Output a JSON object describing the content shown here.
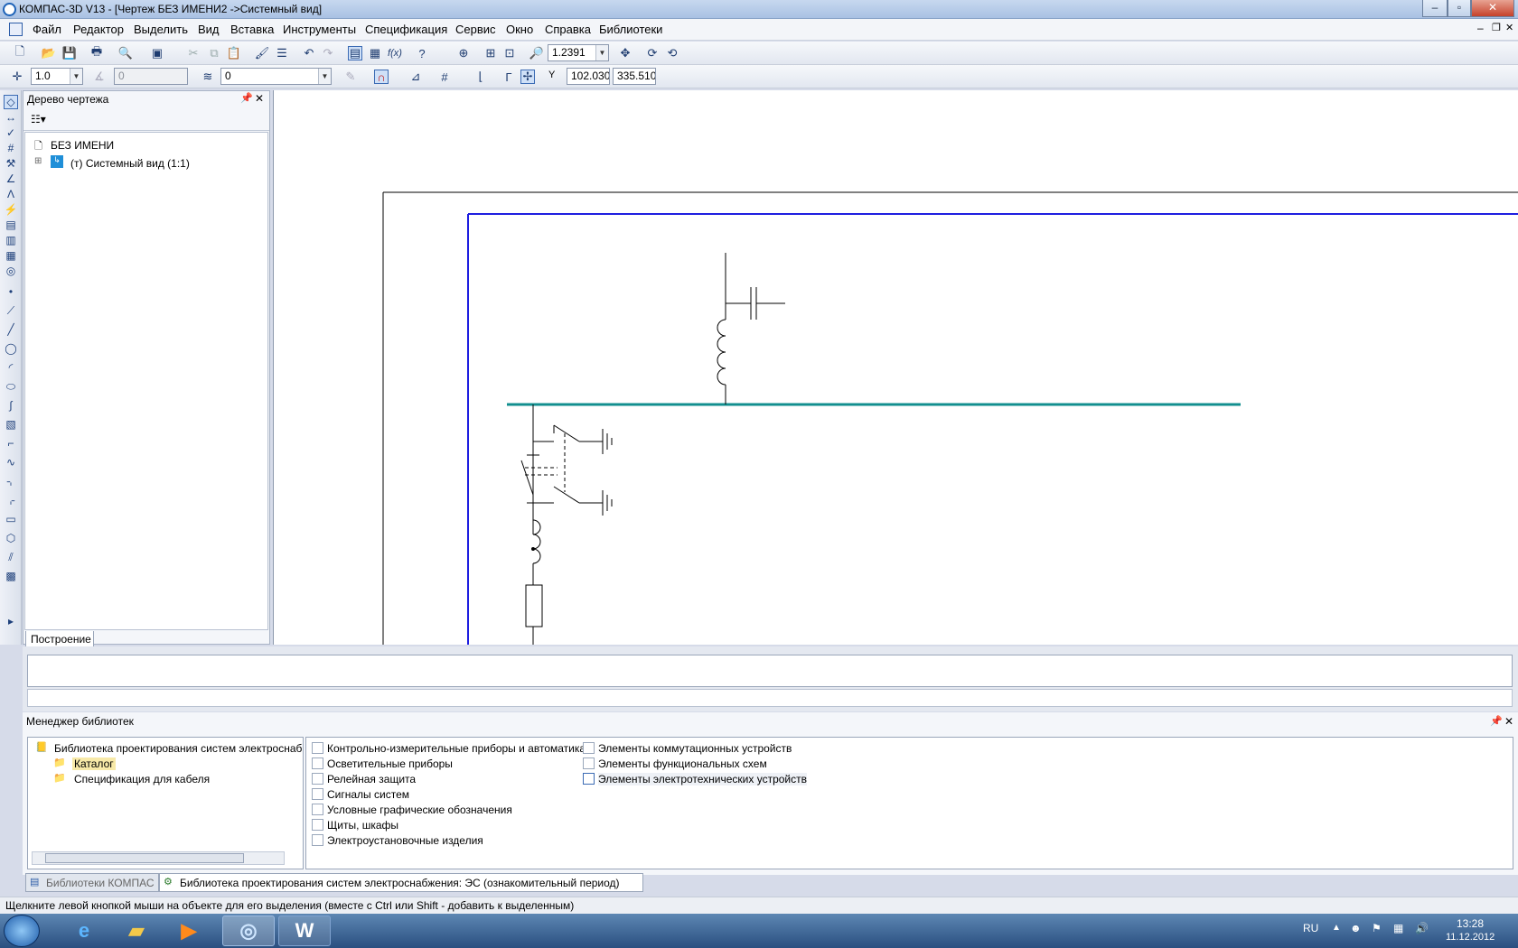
{
  "window": {
    "title": "КОМПАС-3D V13 - [Чертеж БЕЗ ИМЕНИ2 ->Системный вид]",
    "minimize": "–",
    "maximize": "▫",
    "close": "✕"
  },
  "menu": [
    "Файл",
    "Редактор",
    "Выделить",
    "Вид",
    "Вставка",
    "Инструменты",
    "Спецификация",
    "Сервис",
    "Окно",
    "Справка",
    "Библиотеки"
  ],
  "toolbar": {
    "zoom_value": "1.2391"
  },
  "toolbar2": {
    "step_value": "1.0",
    "angle_value": "0",
    "layer_value": "0",
    "x_label": "Y",
    "x_value": "102.030",
    "y_value": "335.510"
  },
  "tree_panel": {
    "title": "Дерево чертежа",
    "root": "БЕЗ ИМЕНИ",
    "child": "(т) Системный вид (1:1)",
    "tab": "Построение"
  },
  "library_manager": {
    "title": "Менеджер библиотек",
    "tree": [
      "Библиотека проектирования систем электроснаб",
      "Каталог",
      "Спецификация для кабеля"
    ],
    "col1": [
      "Контрольно-измерительные приборы и автоматика",
      "Осветительные приборы",
      "Релейная защита",
      "Сигналы систем",
      "Условные графические обозначения",
      "Щиты, шкафы",
      "Электроустановочные изделия"
    ],
    "col2": [
      "Элементы коммутационных устройств",
      "Элементы функциональных схем",
      "Элементы электротехнических устройств"
    ],
    "tabs": [
      "Библиотеки КОМПАС",
      "Библиотека проектирования систем электроснабжения: ЭС (ознакомительный период)"
    ]
  },
  "status_text": "Щелкните левой кнопкой мыши на объекте для его выделения (вместе с Ctrl или Shift - добавить к выделенным)",
  "taskbar": {
    "lang": "RU",
    "time": "13:28",
    "date": "11.12.2012"
  },
  "colors": {
    "bus": "#128f8f",
    "frame_blue": "#1e1ee0"
  }
}
